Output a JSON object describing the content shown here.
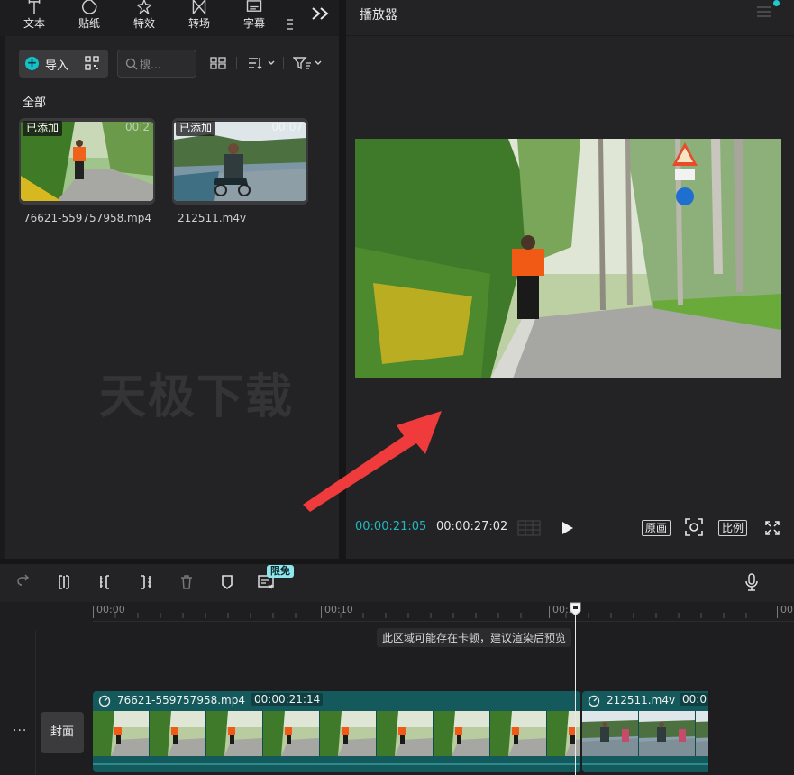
{
  "toolbar_tabs": [
    {
      "label": "文本",
      "icon": "text-icon"
    },
    {
      "label": "贴纸",
      "icon": "sticker-icon"
    },
    {
      "label": "特效",
      "icon": "effects-icon"
    },
    {
      "label": "转场",
      "icon": "transition-icon"
    },
    {
      "label": "字幕",
      "icon": "subtitle-icon"
    }
  ],
  "media": {
    "import_label": "导入",
    "search_placeholder": "搜...",
    "section_label": "全部",
    "items": [
      {
        "added_badge": "已添加",
        "duration": "00:2",
        "filename": "76621-559757958.mp4"
      },
      {
        "added_badge": "已添加",
        "duration": "00:07",
        "filename": "212511.m4v"
      }
    ],
    "watermark": "天极下载"
  },
  "player": {
    "title": "播放器",
    "current_time": "00:00:21:05",
    "total_time": "00:00:27:02",
    "original_label": "原画",
    "ratio_label": "比例"
  },
  "timeline": {
    "free_badge": "限免",
    "ruler_labels": [
      "00:00",
      "00:10",
      "00:2",
      "00"
    ],
    "hint": "此区域可能存在卡顿，建议渲染后预览",
    "cover_label": "封面",
    "more_label": "···",
    "clips": [
      {
        "name": "76621-559757958.mp4",
        "duration": "00:00:21:14"
      },
      {
        "name": "212511.m4v",
        "duration": "00:0"
      }
    ]
  },
  "colors": {
    "accent": "#1fb9c3",
    "clip": "#145a5c",
    "arrow": "#ef3b3b"
  }
}
